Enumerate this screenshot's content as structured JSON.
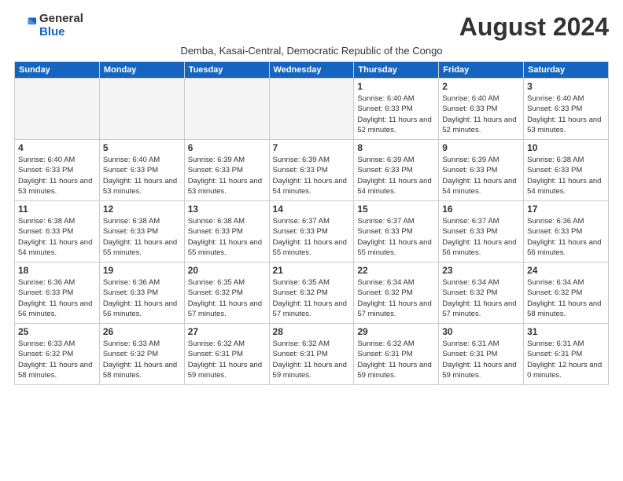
{
  "logo": {
    "general": "General",
    "blue": "Blue"
  },
  "title": "August 2024",
  "subtitle": "Demba, Kasai-Central, Democratic Republic of the Congo",
  "days_of_week": [
    "Sunday",
    "Monday",
    "Tuesday",
    "Wednesday",
    "Thursday",
    "Friday",
    "Saturday"
  ],
  "weeks": [
    [
      {
        "day": "",
        "info": ""
      },
      {
        "day": "",
        "info": ""
      },
      {
        "day": "",
        "info": ""
      },
      {
        "day": "",
        "info": ""
      },
      {
        "day": "1",
        "info": "Sunrise: 6:40 AM\nSunset: 6:33 PM\nDaylight: 11 hours\nand 52 minutes."
      },
      {
        "day": "2",
        "info": "Sunrise: 6:40 AM\nSunset: 6:33 PM\nDaylight: 11 hours\nand 52 minutes."
      },
      {
        "day": "3",
        "info": "Sunrise: 6:40 AM\nSunset: 6:33 PM\nDaylight: 11 hours\nand 53 minutes."
      }
    ],
    [
      {
        "day": "4",
        "info": "Sunrise: 6:40 AM\nSunset: 6:33 PM\nDaylight: 11 hours\nand 53 minutes."
      },
      {
        "day": "5",
        "info": "Sunrise: 6:40 AM\nSunset: 6:33 PM\nDaylight: 11 hours\nand 53 minutes."
      },
      {
        "day": "6",
        "info": "Sunrise: 6:39 AM\nSunset: 6:33 PM\nDaylight: 11 hours\nand 53 minutes."
      },
      {
        "day": "7",
        "info": "Sunrise: 6:39 AM\nSunset: 6:33 PM\nDaylight: 11 hours\nand 54 minutes."
      },
      {
        "day": "8",
        "info": "Sunrise: 6:39 AM\nSunset: 6:33 PM\nDaylight: 11 hours\nand 54 minutes."
      },
      {
        "day": "9",
        "info": "Sunrise: 6:39 AM\nSunset: 6:33 PM\nDaylight: 11 hours\nand 54 minutes."
      },
      {
        "day": "10",
        "info": "Sunrise: 6:38 AM\nSunset: 6:33 PM\nDaylight: 11 hours\nand 54 minutes."
      }
    ],
    [
      {
        "day": "11",
        "info": "Sunrise: 6:38 AM\nSunset: 6:33 PM\nDaylight: 11 hours\nand 54 minutes."
      },
      {
        "day": "12",
        "info": "Sunrise: 6:38 AM\nSunset: 6:33 PM\nDaylight: 11 hours\nand 55 minutes."
      },
      {
        "day": "13",
        "info": "Sunrise: 6:38 AM\nSunset: 6:33 PM\nDaylight: 11 hours\nand 55 minutes."
      },
      {
        "day": "14",
        "info": "Sunrise: 6:37 AM\nSunset: 6:33 PM\nDaylight: 11 hours\nand 55 minutes."
      },
      {
        "day": "15",
        "info": "Sunrise: 6:37 AM\nSunset: 6:33 PM\nDaylight: 11 hours\nand 55 minutes."
      },
      {
        "day": "16",
        "info": "Sunrise: 6:37 AM\nSunset: 6:33 PM\nDaylight: 11 hours\nand 56 minutes."
      },
      {
        "day": "17",
        "info": "Sunrise: 6:36 AM\nSunset: 6:33 PM\nDaylight: 11 hours\nand 56 minutes."
      }
    ],
    [
      {
        "day": "18",
        "info": "Sunrise: 6:36 AM\nSunset: 6:33 PM\nDaylight: 11 hours\nand 56 minutes."
      },
      {
        "day": "19",
        "info": "Sunrise: 6:36 AM\nSunset: 6:33 PM\nDaylight: 11 hours\nand 56 minutes."
      },
      {
        "day": "20",
        "info": "Sunrise: 6:35 AM\nSunset: 6:32 PM\nDaylight: 11 hours\nand 57 minutes."
      },
      {
        "day": "21",
        "info": "Sunrise: 6:35 AM\nSunset: 6:32 PM\nDaylight: 11 hours\nand 57 minutes."
      },
      {
        "day": "22",
        "info": "Sunrise: 6:34 AM\nSunset: 6:32 PM\nDaylight: 11 hours\nand 57 minutes."
      },
      {
        "day": "23",
        "info": "Sunrise: 6:34 AM\nSunset: 6:32 PM\nDaylight: 11 hours\nand 57 minutes."
      },
      {
        "day": "24",
        "info": "Sunrise: 6:34 AM\nSunset: 6:32 PM\nDaylight: 11 hours\nand 58 minutes."
      }
    ],
    [
      {
        "day": "25",
        "info": "Sunrise: 6:33 AM\nSunset: 6:32 PM\nDaylight: 11 hours\nand 58 minutes."
      },
      {
        "day": "26",
        "info": "Sunrise: 6:33 AM\nSunset: 6:32 PM\nDaylight: 11 hours\nand 58 minutes."
      },
      {
        "day": "27",
        "info": "Sunrise: 6:32 AM\nSunset: 6:31 PM\nDaylight: 11 hours\nand 59 minutes."
      },
      {
        "day": "28",
        "info": "Sunrise: 6:32 AM\nSunset: 6:31 PM\nDaylight: 11 hours\nand 59 minutes."
      },
      {
        "day": "29",
        "info": "Sunrise: 6:32 AM\nSunset: 6:31 PM\nDaylight: 11 hours\nand 59 minutes."
      },
      {
        "day": "30",
        "info": "Sunrise: 6:31 AM\nSunset: 6:31 PM\nDaylight: 11 hours\nand 59 minutes."
      },
      {
        "day": "31",
        "info": "Sunrise: 6:31 AM\nSunset: 6:31 PM\nDaylight: 12 hours\nand 0 minutes."
      }
    ]
  ]
}
